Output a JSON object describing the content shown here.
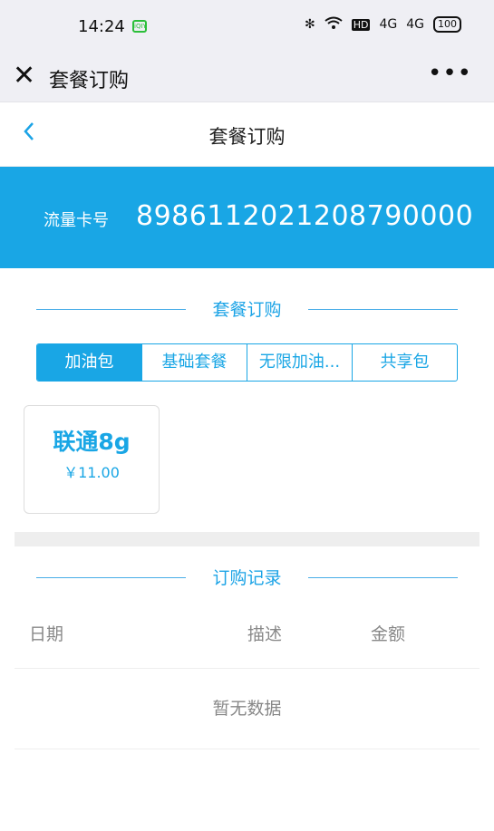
{
  "status_bar": {
    "time": "14:24",
    "app_icon_text": "iQIY",
    "bluetooth": "✻",
    "wifi": "wifi",
    "hd": "HD",
    "signal1": "4G",
    "signal2": "4G",
    "battery": "100"
  },
  "wx_header": {
    "title": "套餐订购",
    "close_icon": "✕",
    "more_icon": "•••"
  },
  "page": {
    "title": "套餐订购",
    "back_icon": "‹"
  },
  "card": {
    "label": "流量卡号",
    "number": "8986112021208790000"
  },
  "section_order": {
    "title": "套餐订购"
  },
  "tabs": [
    {
      "label": "加油包",
      "active": true
    },
    {
      "label": "基础套餐",
      "active": false
    },
    {
      "label": "无限加油...",
      "active": false
    },
    {
      "label": "共享包",
      "active": false
    }
  ],
  "packages": [
    {
      "name": "联通8g",
      "price": "￥11.00"
    }
  ],
  "section_records": {
    "title": "订购记录"
  },
  "records_table": {
    "headers": [
      "日期",
      "描述",
      "金额"
    ],
    "empty_text": "暂无数据"
  },
  "colors": {
    "accent": "#19a6e5",
    "status_app": "#2cbf3a"
  }
}
